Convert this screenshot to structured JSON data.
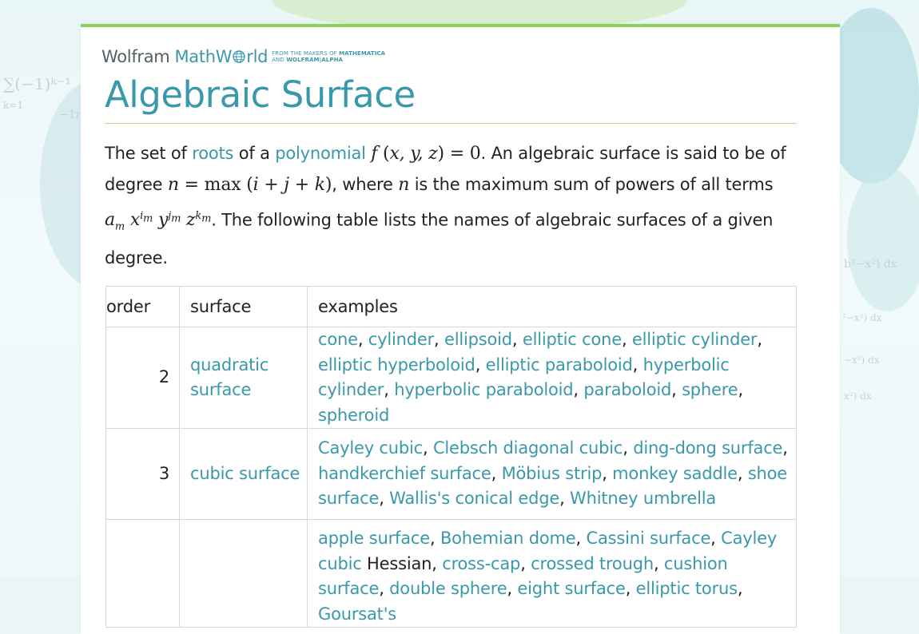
{
  "brand": {
    "wolfram": "Wolfram",
    "mathworld_pre": "MathW",
    "mathworld_post": "rld",
    "tagline_1": "FROM THE MAKERS OF",
    "tagline_1b": "MATHEMATICA",
    "tagline_2": "AND",
    "tagline_2b": "WOLFRAM|ALPHA"
  },
  "page": {
    "title": "Algebraic Surface"
  },
  "intro": {
    "t1": "The set of ",
    "link_roots": "roots",
    "t2": " of a ",
    "link_polynomial": "polynomial",
    "t3": ". An algebraic surface is said to be of degree ",
    "t4": ", where ",
    "t5": " is the maximum sum of powers of all terms ",
    "t6": ". The following table lists the names of algebraic surfaces of a given degree."
  },
  "table": {
    "headers": [
      "order",
      "surface",
      "examples"
    ],
    "rows": [
      {
        "order": "2",
        "surface": "quadratic surface",
        "examples": [
          "cone",
          "cylinder",
          "ellipsoid",
          "elliptic cone",
          "elliptic cylinder",
          "elliptic hyperboloid",
          "elliptic paraboloid",
          "hyperbolic cylinder",
          "hyperbolic paraboloid",
          "paraboloid",
          "sphere",
          "spheroid"
        ]
      },
      {
        "order": "3",
        "surface": "cubic surface",
        "examples": [
          "Cayley cubic",
          "Clebsch diagonal cubic",
          "ding-dong surface",
          "handkerchief surface",
          "Möbius strip",
          "monkey saddle",
          "shoe surface",
          "Wallis's conical edge",
          "Whitney umbrella"
        ]
      },
      {
        "order": "",
        "surface": "",
        "examples_a": [
          "apple surface",
          "Bohemian dome",
          "Cassini surface",
          "Cayley cubic"
        ],
        "examples_plain": " Hessian",
        "examples_b": [
          "cross-cap",
          "crossed trough",
          "cushion surface",
          "double sphere",
          "eight surface",
          "elliptic torus",
          "Goursat's"
        ]
      }
    ]
  },
  "icons": [
    "wolfram-globe-icon"
  ]
}
